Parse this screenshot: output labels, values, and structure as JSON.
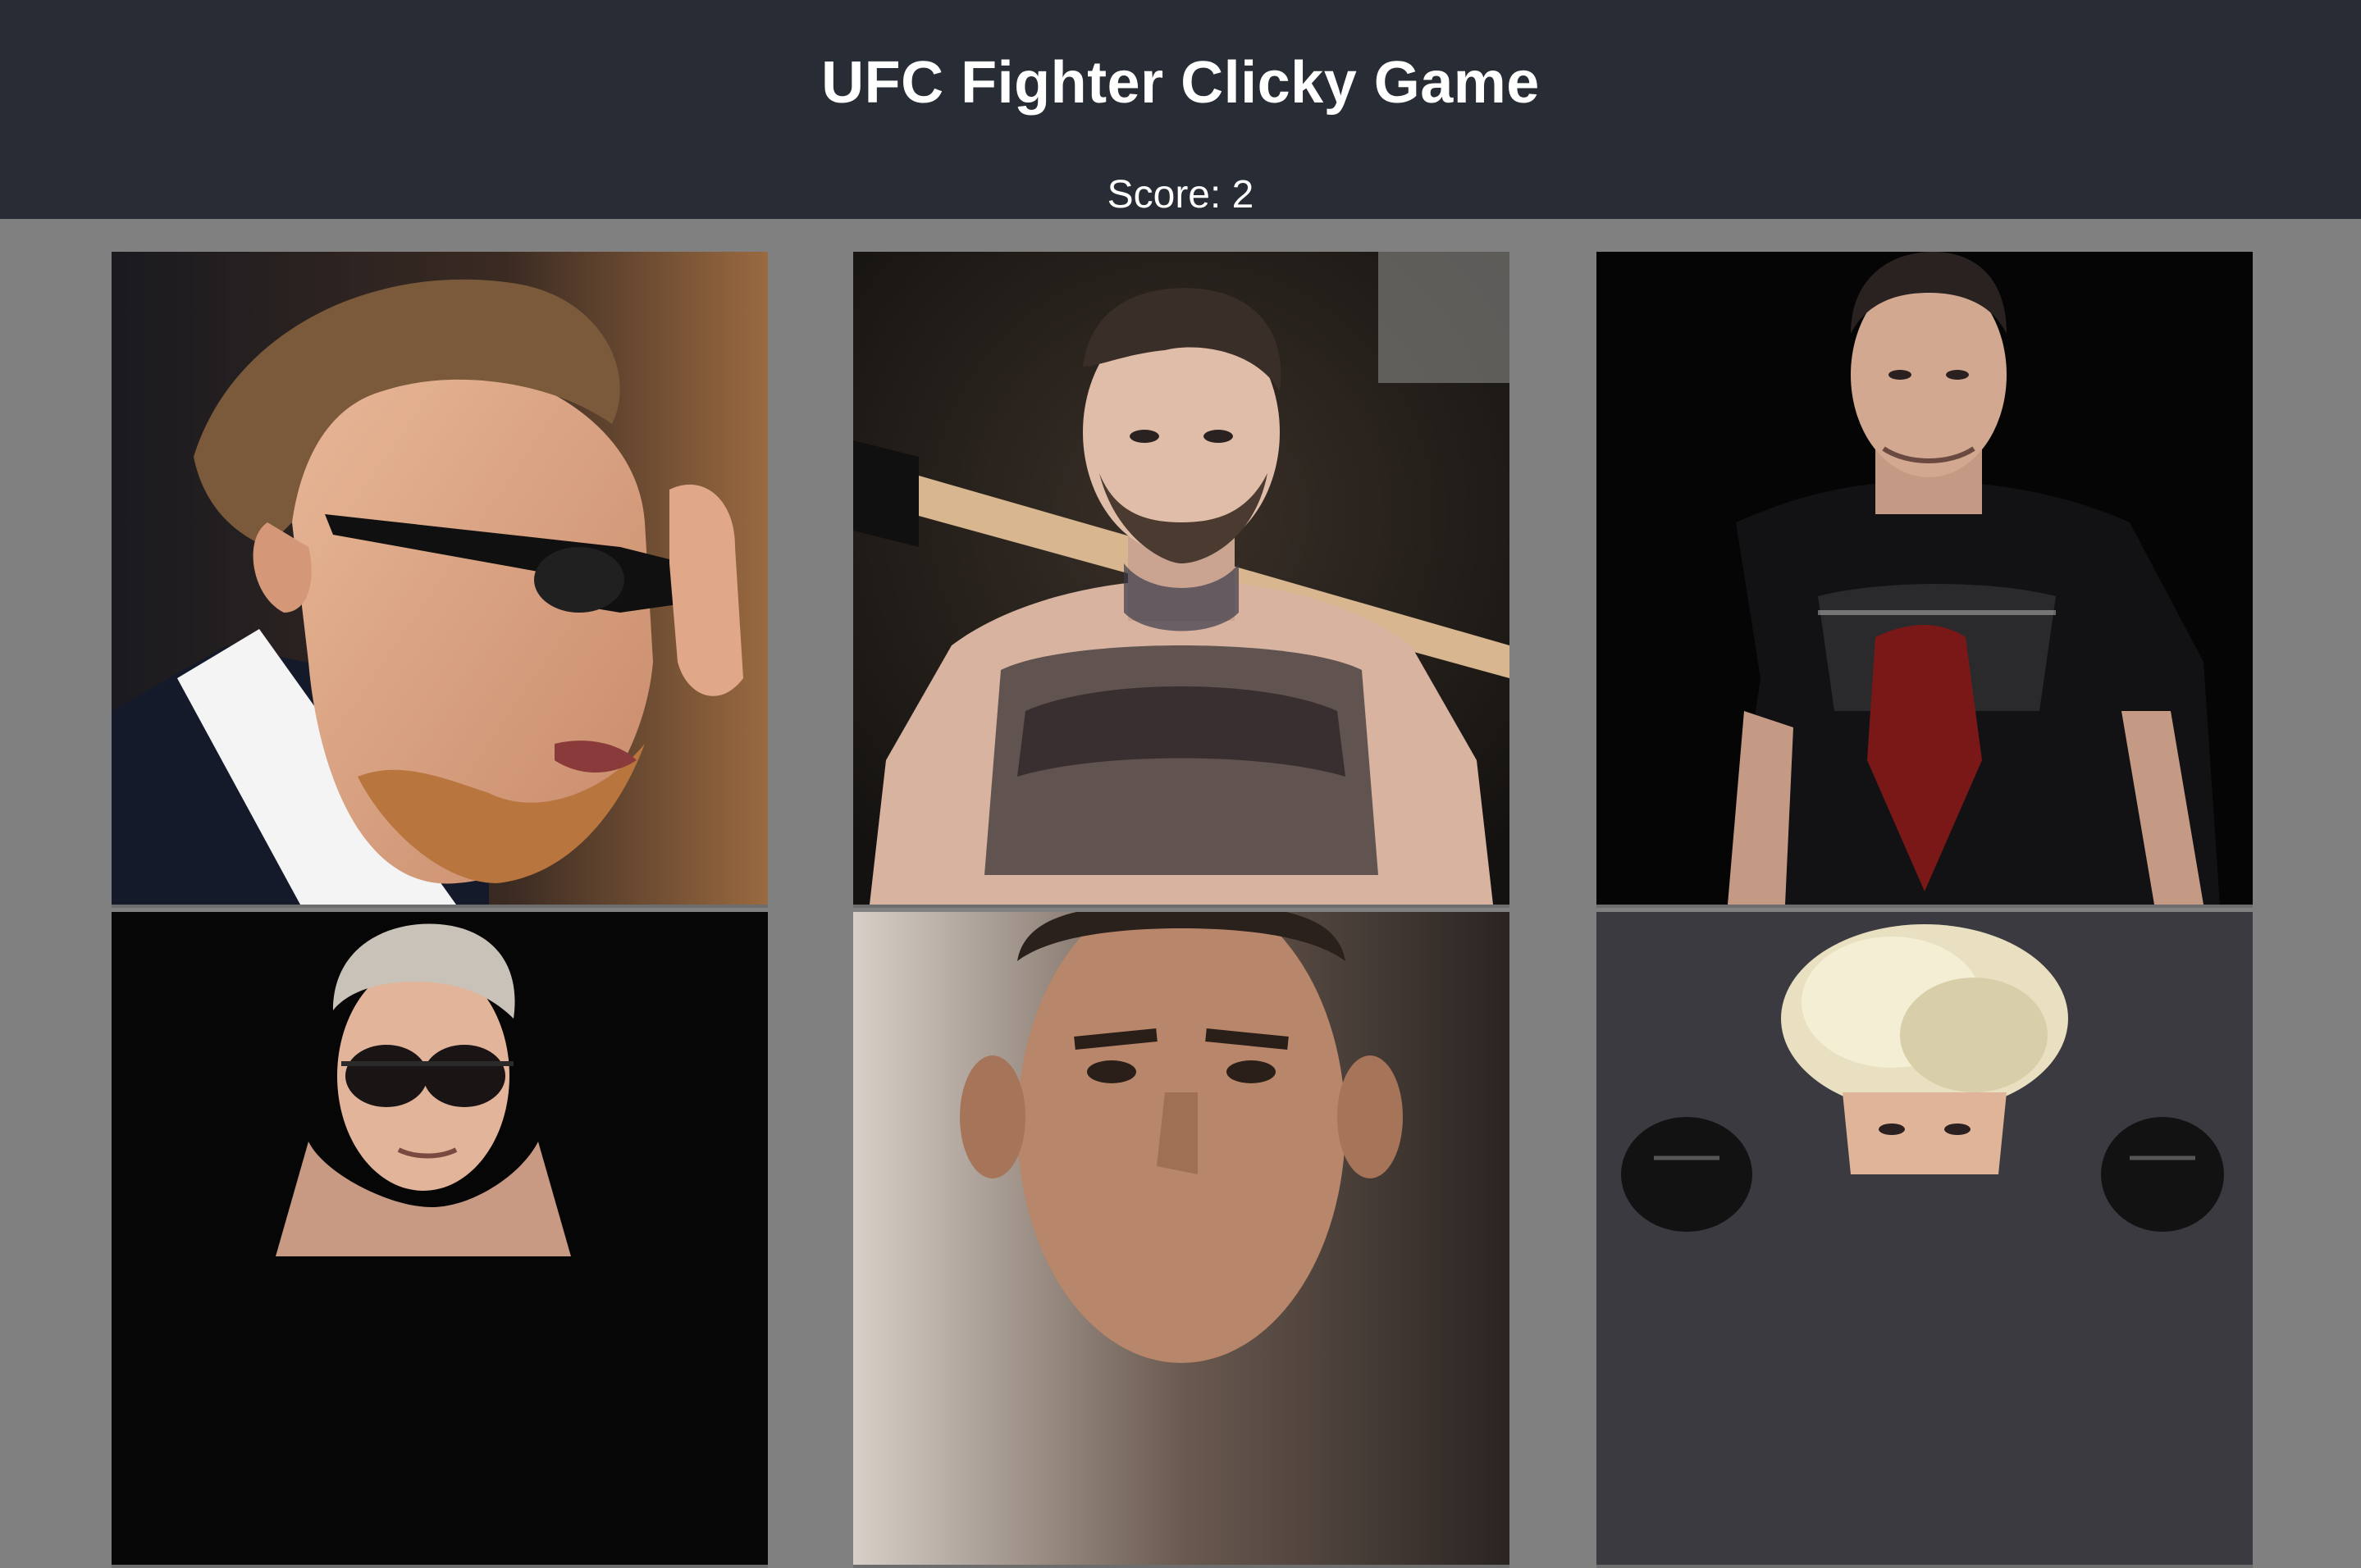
{
  "header": {
    "title": "UFC Fighter Clicky Game",
    "score_label": "Score: 2"
  },
  "colors": {
    "header_bg": "#282c34",
    "page_bg": "#808080",
    "text": "#ffffff"
  },
  "cards": [
    {
      "kind": "fighter-photo",
      "pose": "sunglasses-profile"
    },
    {
      "kind": "fighter-photo",
      "pose": "tattooed-bat"
    },
    {
      "kind": "fighter-photo",
      "pose": "black-tshirt"
    },
    {
      "kind": "fighter-photo",
      "pose": "aviator-sunglasses"
    },
    {
      "kind": "fighter-photo",
      "pose": "closeup-face"
    },
    {
      "kind": "fighter-photo",
      "pose": "papakha-hat"
    }
  ]
}
